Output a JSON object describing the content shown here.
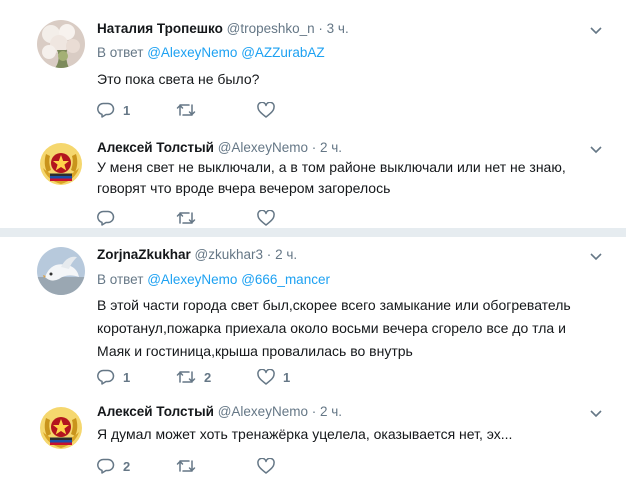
{
  "tweets": [
    {
      "name": "Наталия Тропешко",
      "handle": "@tropeshko_n",
      "sep": "·",
      "time": "3 ч.",
      "reply_prefix": "В ответ",
      "reply_to": [
        "@AlexeyNemo",
        "@AZZurabAZ"
      ],
      "text": "Это пока света не было?",
      "counts": {
        "reply": "1",
        "retweet": "",
        "like": ""
      },
      "avatar_icon": "flowers-photo"
    },
    {
      "name": "Алексей Толстый",
      "handle": "@AlexeyNemo",
      "sep": "·",
      "time": "2 ч.",
      "text": "У меня свет не выключали, а в том районе выключали или нет не знаю, говорят что вроде вчера вечером загорелось",
      "counts": {
        "reply": "",
        "retweet": "",
        "like": ""
      },
      "avatar_icon": "coat-of-arms-emblem"
    },
    {
      "name": "ZorjnaZkukhar",
      "handle": "@zkukhar3",
      "sep": "·",
      "time": "2 ч.",
      "reply_prefix": "В ответ",
      "reply_to": [
        "@AlexeyNemo",
        "@666_mancer"
      ],
      "text": "В этой части города свет был,скорее всего замыкание или обогреватель коротанул,пожарка приехала  около восьми вечера сгорело все до тла и Маяк и гостиница,крыша провалилась во внутрь",
      "counts": {
        "reply": "1",
        "retweet": "2",
        "like": "1"
      },
      "avatar_icon": "dove-photo"
    },
    {
      "name": "Алексей Толстый",
      "handle": "@AlexeyNemo",
      "sep": "·",
      "time": "2 ч.",
      "text": "Я думал может хоть тренажёрка уцелела, оказывается нет, эх...",
      "counts": {
        "reply": "2",
        "retweet": "",
        "like": ""
      },
      "avatar_icon": "coat-of-arms-emblem"
    }
  ],
  "colors": {
    "link": "#1da1f2",
    "muted": "#657786",
    "text": "#14171a",
    "divider": "#e6ecf0"
  }
}
